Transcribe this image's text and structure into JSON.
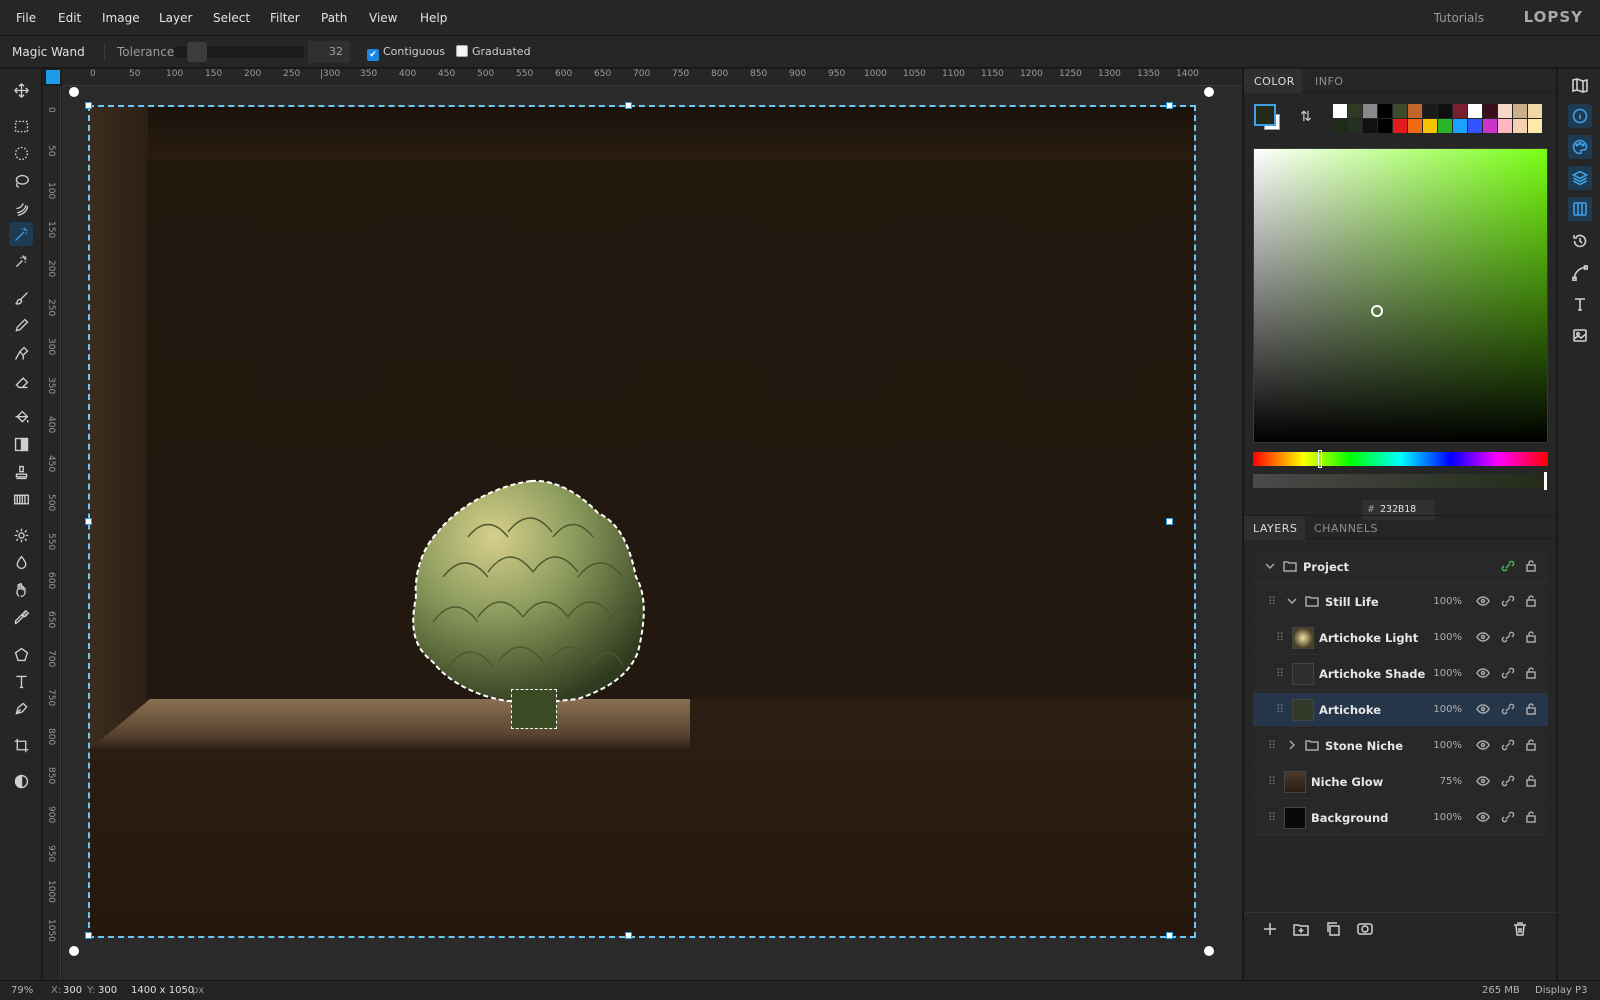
{
  "menu": {
    "items": [
      "File",
      "Edit",
      "Image",
      "Layer",
      "Select",
      "Filter",
      "Path",
      "View",
      "Help"
    ],
    "tutorials": "Tutorials",
    "logo": "LOPSY"
  },
  "options": {
    "tool": "Magic Wand",
    "tolerance_label": "Tolerance",
    "tolerance_value": "32",
    "contiguous_label": "Contiguous",
    "contiguous_checked": true,
    "graduated_label": "Graduated",
    "graduated_checked": false,
    "tolerance_fraction": 0.1
  },
  "rulers": {
    "h": [
      "0",
      "50",
      "100",
      "150",
      "200",
      "250",
      "300",
      "350",
      "400",
      "450",
      "500",
      "550",
      "600",
      "650",
      "700",
      "750",
      "800",
      "850",
      "900",
      "950",
      "1000",
      "1050",
      "1100",
      "1150",
      "1200",
      "1250",
      "1300",
      "1350",
      "1400"
    ],
    "v": [
      "0",
      "50",
      "100",
      "150",
      "200",
      "250",
      "300",
      "350",
      "400",
      "450",
      "500",
      "550",
      "600",
      "650",
      "700",
      "750",
      "800",
      "850",
      "900",
      "950",
      "1000",
      "1050"
    ]
  },
  "tools": [
    "move-icon",
    "rect-select-icon",
    "ellipse-select-icon",
    "lasso-icon",
    "quick-select-icon",
    "magic-wand-icon",
    "spot-heal-icon",
    "brush-icon",
    "pencil-icon",
    "clone-icon",
    "eraser-icon",
    "bucket-icon",
    "gradient-icon",
    "stamp-icon",
    "pattern-icon",
    "dodge-icon",
    "burn-icon",
    "smudge-icon",
    "eyedropper-icon",
    "shape-icon",
    "text-icon",
    "pen-icon",
    "crop-icon",
    "contrast-icon"
  ],
  "color_panel": {
    "tabs": [
      "COLOR",
      "INFO"
    ],
    "active_tab": "COLOR",
    "foreground": "#232B18",
    "background": "#FFFFFF",
    "hex_label": "#",
    "hex_value": "232B18",
    "swatches_row1": [
      "#ffffff",
      "#2e3a24",
      "#8a8a8a",
      "#000000",
      "#3d4a2c",
      "#c2652a",
      "#1a1a1a",
      "#0f0f0f",
      "#7a1f2e",
      "#ffffff",
      "#3a0f1a",
      "#f7d8c8",
      "#c9b08a",
      "#f1d7a4"
    ],
    "swatches_row2": [
      "#1f2a18",
      "#263020",
      "#111111",
      "#000000",
      "#e31b1b",
      "#f06a15",
      "#f5c400",
      "#28b52b",
      "#1ea0ff",
      "#3355ff",
      "#cc33cc",
      "#ffb6c1",
      "#f3d0b0",
      "#ffe9a8"
    ]
  },
  "layers_panel": {
    "tabs": [
      "LAYERS",
      "CHANNELS"
    ],
    "active_tab": "LAYERS",
    "layers": [
      {
        "name": "Project",
        "opacity": "",
        "type": "group-root"
      },
      {
        "name": "Still Life",
        "opacity": "100%",
        "type": "group-open"
      },
      {
        "name": "Artichoke Light",
        "opacity": "100%",
        "type": "layer"
      },
      {
        "name": "Artichoke Shade",
        "opacity": "100%",
        "type": "layer"
      },
      {
        "name": "Artichoke",
        "opacity": "100%",
        "type": "layer",
        "selected": true
      },
      {
        "name": "Stone Niche",
        "opacity": "100%",
        "type": "group-closed"
      },
      {
        "name": "Niche Glow",
        "opacity": "75%",
        "type": "layer"
      },
      {
        "name": "Background",
        "opacity": "100%",
        "type": "layer"
      }
    ]
  },
  "right_strip": [
    "map-icon",
    "info-icon",
    "palette-icon",
    "layers-icon",
    "channels-icon",
    "history-icon",
    "path-icon",
    "type-icon",
    "image-icon"
  ],
  "status": {
    "zoom": "79%",
    "x_label": "X:",
    "x": "300",
    "y_label": "Y:",
    "y": "300",
    "size": "1400 x 1050",
    "unit": "px",
    "memory": "265 MB",
    "profile": "Display P3"
  }
}
